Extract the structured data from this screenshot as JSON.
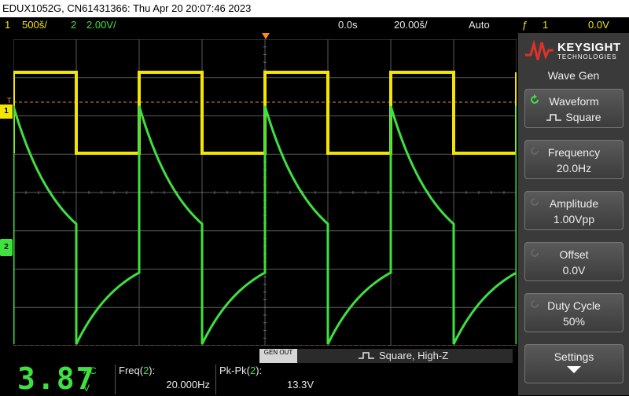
{
  "titlebar": {
    "text": "EDUX1052G, CN61431366: Thu Apr 20 20:07:46 2023"
  },
  "status": {
    "ch1_num": "1",
    "ch1_scale": "500š/",
    "ch2_num": "2",
    "ch2_scale": "2.00V/",
    "time_offset": "0.0s",
    "time_scale": "20.00š/",
    "trigger_mode": "Auto",
    "trigger_source": "1",
    "trigger_level": "0.0V"
  },
  "markers": {
    "ch1": "1",
    "ch2": "2",
    "trigger": "T"
  },
  "gen_bar": {
    "button": "GEN OUT",
    "label": "Square, High-Z"
  },
  "measure": {
    "big_value": "3.87",
    "coupling": "AC",
    "unit": "V",
    "freq_label": "Freq(",
    "freq_ch": "2",
    "freq_close": "):",
    "freq_value": "20.000Hz",
    "pkpk_label": "Pk-Pk(",
    "pkpk_ch": "2",
    "pkpk_close": "):",
    "pkpk_value": "13.3V"
  },
  "brand": {
    "name": "KEYSIGHT",
    "sub": "TECHNOLOGIES"
  },
  "menu": {
    "title": "Wave Gen",
    "keys": [
      {
        "title": "Waveform",
        "value": "Square"
      },
      {
        "title": "Frequency",
        "value": "20.0Hz"
      },
      {
        "title": "Amplitude",
        "value": "1.00Vpp"
      },
      {
        "title": "Offset",
        "value": "0.0V"
      },
      {
        "title": "Duty Cycle",
        "value": "50%"
      },
      {
        "title": "Settings",
        "value": ""
      }
    ]
  },
  "colors": {
    "ch1": "#f2e600",
    "ch2": "#3fe03f",
    "trigger": "#ff8c4a"
  }
}
